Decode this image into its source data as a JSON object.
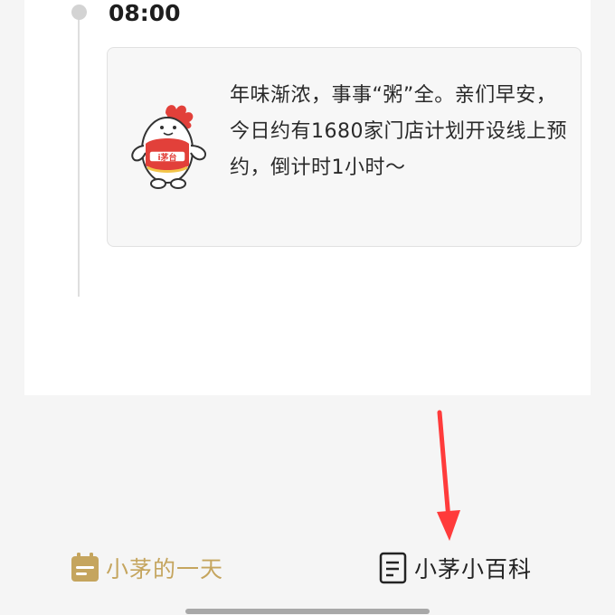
{
  "timeline": {
    "time": "08:00",
    "message": "年味渐浓，事事“粥”全。亲们早安，今日约有1680家门店计划开设线上预约，倒计时1小时～",
    "mascot_label": "i茅台"
  },
  "bottom_nav": {
    "items": [
      {
        "label": "小茅的一天",
        "icon": "calendar-notepad-icon",
        "active": true
      },
      {
        "label": "小茅小百科",
        "icon": "document-icon",
        "active": false
      }
    ]
  },
  "colors": {
    "accent": "#c5a55e",
    "annotation_arrow": "#ff3b3b",
    "mascot_red": "#e2403a"
  }
}
